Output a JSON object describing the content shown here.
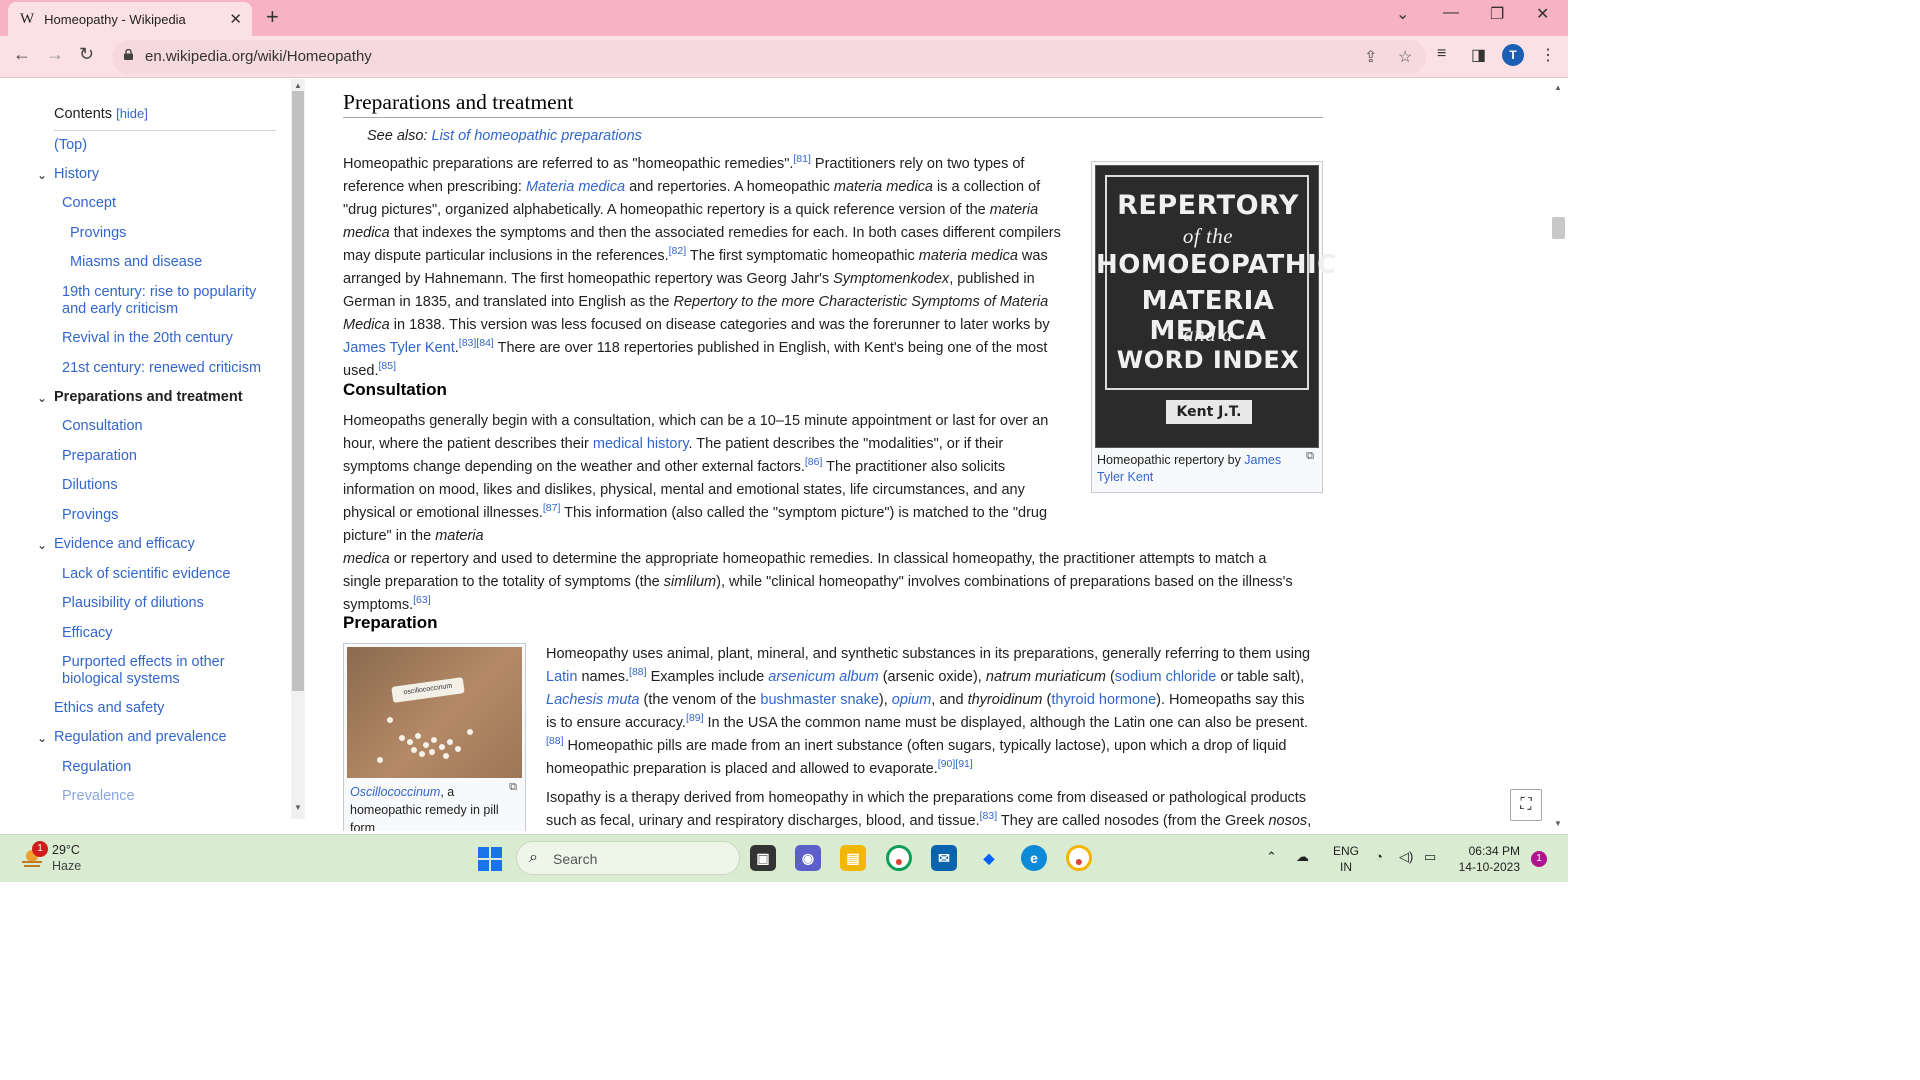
{
  "browser": {
    "tab_title": "Homeopathy - Wikipedia",
    "tab_logo": "W",
    "url": "en.wikipedia.org/wiki/Homeopathy",
    "profile_initial": "T",
    "accent_color": "#f7b3c2"
  },
  "toc": {
    "title": "Contents",
    "hide_label": "[hide]",
    "items": [
      {
        "label": "(Top)"
      },
      {
        "label": "History"
      },
      {
        "label": "Concept"
      },
      {
        "label": "Provings"
      },
      {
        "label": "Miasms and disease"
      },
      {
        "label": "19th century: rise to popularity and early criticism"
      },
      {
        "label": "Revival in the 20th century"
      },
      {
        "label": "21st century: renewed criticism"
      },
      {
        "label": "Preparations and treatment"
      },
      {
        "label": "Consultation"
      },
      {
        "label": "Preparation"
      },
      {
        "label": "Dilutions"
      },
      {
        "label": "Provings"
      },
      {
        "label": "Evidence and efficacy"
      },
      {
        "label": "Lack of scientific evidence"
      },
      {
        "label": "Plausibility of dilutions"
      },
      {
        "label": "Efficacy"
      },
      {
        "label": "Purported effects in other biological systems"
      },
      {
        "label": "Ethics and safety"
      },
      {
        "label": "Regulation and prevalence"
      },
      {
        "label": "Regulation"
      },
      {
        "label": "Prevalence"
      }
    ]
  },
  "article": {
    "section_title": "Preparations and treatment",
    "see_also_prefix": "See also: ",
    "see_also_link": "List of homeopathic preparations",
    "consultation_heading": "Consultation",
    "preparation_heading": "Preparation",
    "fig1_caption_prefix": "Homeopathic repertory by ",
    "fig1_caption_link": "James Tyler Kent",
    "fig1_book": {
      "line1": "REPERTORY",
      "line2": "of the",
      "line3": "HOMOEOPATHIC",
      "line4": "MATERIA MEDICA",
      "line5": "and a",
      "line6": "WORD INDEX",
      "label": "Kent J.T."
    },
    "fig2_caption_link": "Oscillococcinum",
    "fig2_caption_rest": ", a homeopathic remedy in pill form",
    "fig2_tube_label": "oscillococcinum"
  },
  "taskbar": {
    "temperature": "29°C",
    "condition": "Haze",
    "weather_badge": "1",
    "search_placeholder": "Search",
    "lang_line1": "ENG",
    "lang_line2": "IN",
    "time": "06:34 PM",
    "date": "14-10-2023",
    "notification_count": "1"
  }
}
